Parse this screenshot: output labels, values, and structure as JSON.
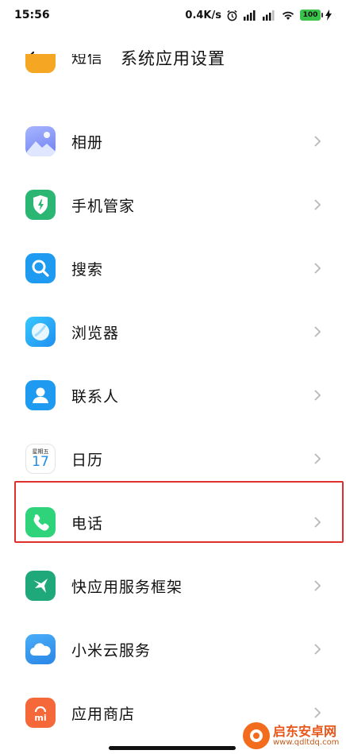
{
  "status_bar": {
    "time": "15:56",
    "speed": "0.4K/s",
    "battery": "100"
  },
  "header": {
    "title": "系统应用设置"
  },
  "items": [
    {
      "label": "短信",
      "icon": "message-icon",
      "color": "#f5a623"
    },
    {
      "label": "相册",
      "icon": "gallery-icon",
      "color": "#7b8cf0"
    },
    {
      "label": "手机管家",
      "icon": "security-shield-icon",
      "color": "#2bb673"
    },
    {
      "label": "搜索",
      "icon": "search-icon",
      "color": "#1e9bf0"
    },
    {
      "label": "浏览器",
      "icon": "browser-icon",
      "color": "#28b6f6"
    },
    {
      "label": "联系人",
      "icon": "contacts-icon",
      "color": "#1e9bf0"
    },
    {
      "label": "日历",
      "icon": "calendar-icon",
      "color": "#ffffff"
    },
    {
      "label": "电话",
      "icon": "phone-icon",
      "color": "#2ed37a"
    },
    {
      "label": "快应用服务框架",
      "icon": "quick-app-icon",
      "color": "#1fa87a"
    },
    {
      "label": "小米云服务",
      "icon": "cloud-icon",
      "color": "#3a9ff0"
    },
    {
      "label": "应用商店",
      "icon": "store-icon",
      "color": "#f5683a"
    }
  ],
  "calendar_icon": {
    "weekday": "星期五",
    "day": "17"
  },
  "store_icon_text": "mi",
  "watermark": {
    "name": "启东安卓网",
    "url": "www.qdltdq.com"
  },
  "colors": {
    "highlight": "#e0302a",
    "chevron": "#b8b8b8"
  }
}
